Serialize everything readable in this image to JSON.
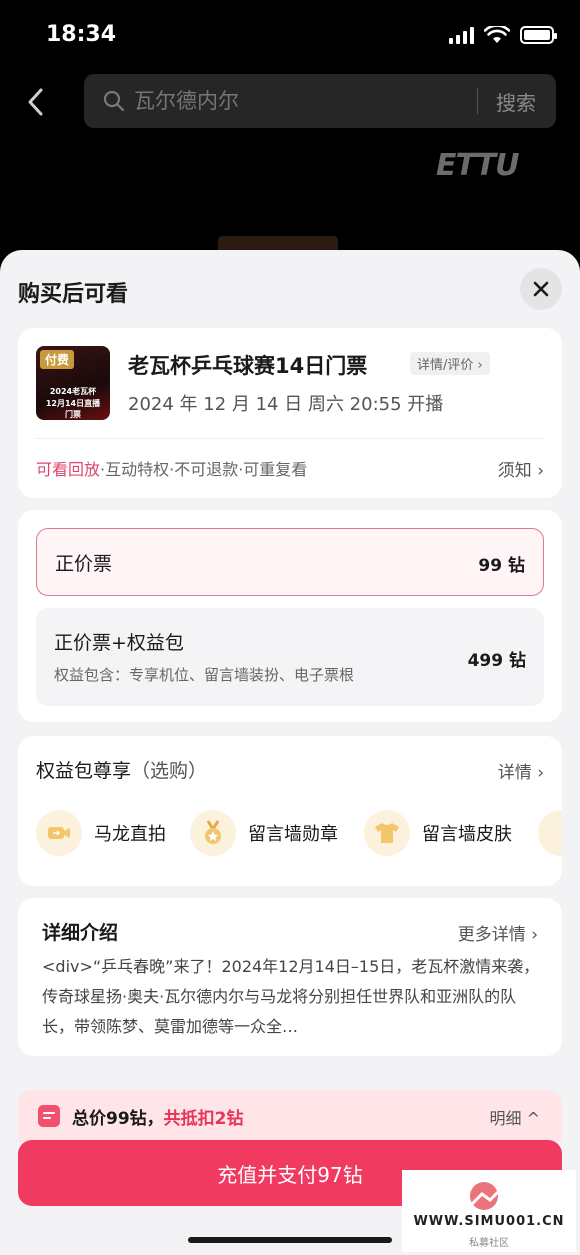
{
  "status_bar": {
    "time": "18:34"
  },
  "nav": {
    "search_placeholder": "瓦尔德内尔",
    "search_button": "搜索"
  },
  "background": {
    "logo_text": "ETTU"
  },
  "sheet": {
    "title": "购买后可看",
    "event": {
      "poster_tag": "付费",
      "poster_line1": "2024老瓦杯",
      "poster_line2": "12月14日直播门票",
      "title": "老瓦杯乒乓球赛14日门票",
      "detail_link": "详情/评价 ›",
      "time": "2024 年 12 月 14 日 周六 20:55 开播",
      "tag_highlight": "可看回放",
      "tags_rest": "·互动特权·不可退款·可重复看",
      "notice": "须知 ›"
    },
    "tickets": [
      {
        "name": "正价票",
        "price": "99 钻",
        "selected": true
      },
      {
        "name": "正价票+权益包",
        "sub": "权益包含：专享机位、留言墙装扮、电子票根",
        "price": "499 钻",
        "selected": false
      }
    ],
    "benefits": {
      "title": "权益包尊享",
      "title_suffix": "（选购）",
      "link": "详情 ›",
      "items": [
        {
          "icon": "camera-icon",
          "label": "马龙直拍"
        },
        {
          "icon": "medal-icon",
          "label": "留言墙勋章"
        },
        {
          "icon": "shirt-icon",
          "label": "留言墙皮肤"
        }
      ]
    },
    "detail": {
      "title": "详细介绍",
      "more": "更多详情 ›",
      "body": "<div>“乒乓春晚”来了！2024年12月14日–15日，老瓦杯激情来袭，传奇球星扬·奥夫·瓦尔德内尔与马龙将分别担任世界队和亚洲队的队长，带领陈梦、莫雷加德等一众全…"
    },
    "footer": {
      "total_prefix": "总价99钻，",
      "total_discount": "共抵扣2钻",
      "breakdown": "明细 ^",
      "pay_button": "充值并支付97钻"
    }
  },
  "watermark": {
    "url": "WWW.SIMU001.CN",
    "sub": "私募社区"
  },
  "colors": {
    "accent": "#f03a60",
    "accent_light": "#ffe4e8",
    "selected_border": "#d97c90",
    "gold": "#c89a3c"
  }
}
